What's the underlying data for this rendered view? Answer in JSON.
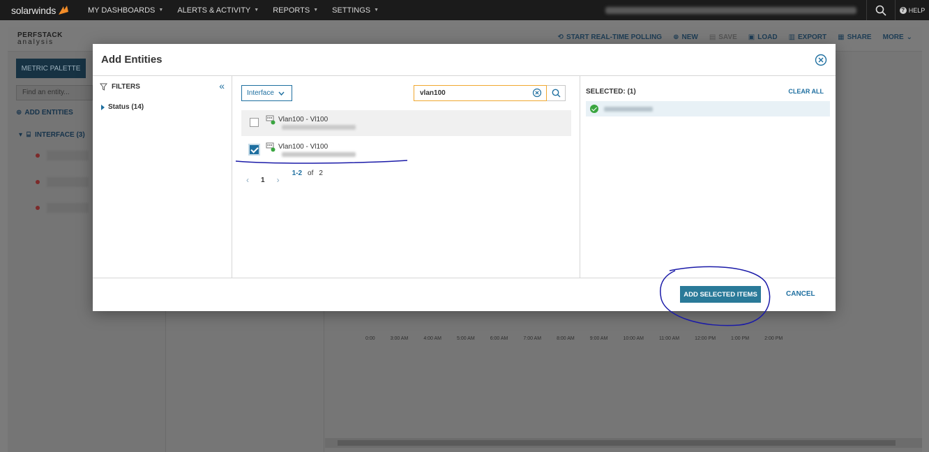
{
  "topnav": {
    "logo": "solarwinds",
    "menu": [
      {
        "label": "MY DASHBOARDS"
      },
      {
        "label": "ALERTS & ACTIVITY"
      },
      {
        "label": "REPORTS"
      },
      {
        "label": "SETTINGS"
      }
    ],
    "help_label": "HELP"
  },
  "background": {
    "perfstack_title": "PERFSTACK",
    "perfstack_sub": "analysis",
    "toolbar": {
      "realtime": "START REAL-TIME POLLING",
      "new": "NEW",
      "save": "SAVE",
      "load": "LOAD",
      "export": "EXPORT",
      "share": "SHARE",
      "more": "MORE"
    },
    "metric_palette": "METRIC PALETTE",
    "find_placeholder": "Find an entity...",
    "add_entities": "ADD ENTITIES",
    "interface_group": "INTERFACE (3)",
    "time_ticks": [
      "0:00",
      "3:00 AM",
      "4:00 AM",
      "5:00 AM",
      "6:00 AM",
      "7:00 AM",
      "8:00 AM",
      "9:00 AM",
      "10:00 AM",
      "11:00 AM",
      "12:00 PM",
      "1:00 PM",
      "2:00 PM"
    ]
  },
  "modal": {
    "title": "Add Entities",
    "filters": {
      "heading": "FILTERS",
      "status": "Status (14)"
    },
    "entity_type": "Interface",
    "search_value": "vlan100",
    "results": [
      {
        "name": "Vlan100 - Vl100",
        "checked": false
      },
      {
        "name": "Vlan100 - Vl100",
        "checked": true
      }
    ],
    "pager": {
      "current_page": "1",
      "range": "1-2",
      "of": "of",
      "total": "2"
    },
    "selected": {
      "title": "SELECTED: (1)",
      "clear_all": "CLEAR ALL"
    },
    "buttons": {
      "add": "ADD SELECTED ITEMS",
      "cancel": "CANCEL"
    }
  },
  "colors": {
    "accent": "#1e6fa0",
    "primary_button": "#2a7a99",
    "search_border": "#f0a830",
    "annotation": "#1a1aa8"
  }
}
